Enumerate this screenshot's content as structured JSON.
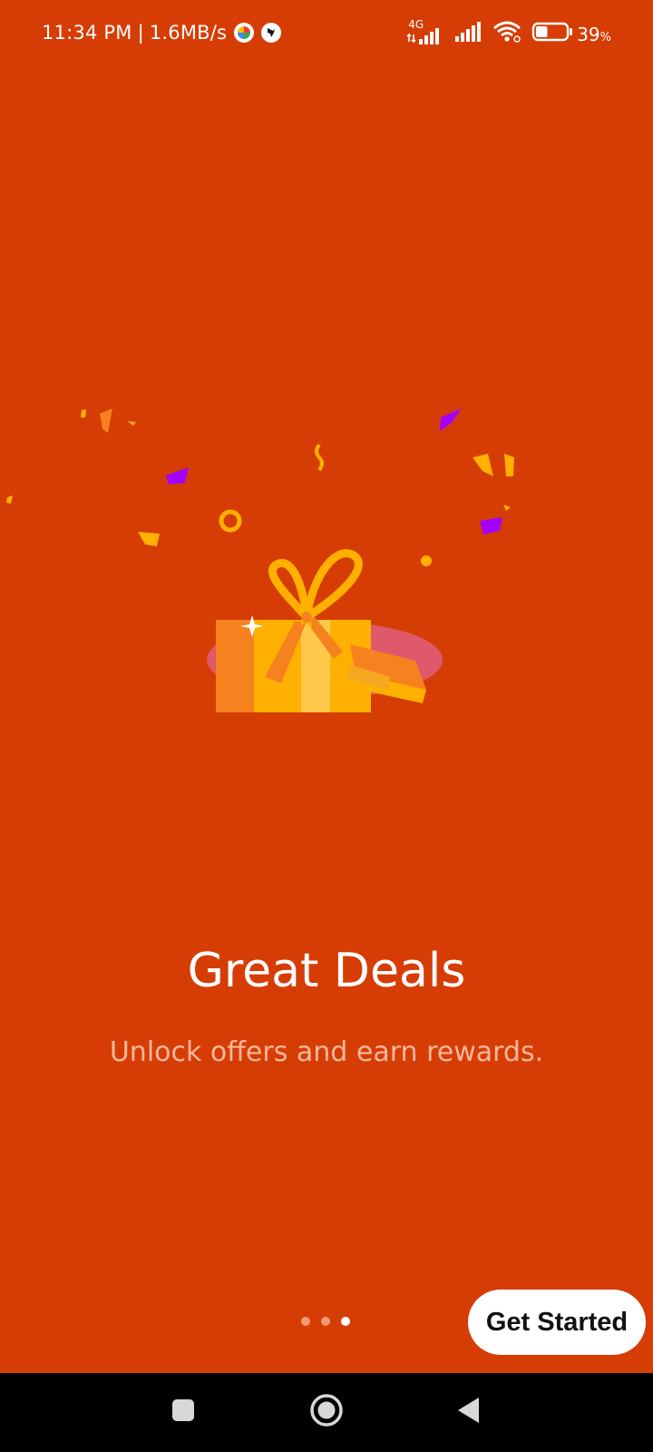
{
  "status_bar": {
    "time": "11:34 PM",
    "separator": "|",
    "net_speed": "1.6MB/s",
    "network_label": "4G",
    "battery_percent": "39",
    "battery_unit": "%",
    "battery_level": 0.39
  },
  "onboarding": {
    "title": "Great Deals",
    "subtitle": "Unlock offers and earn rewards.",
    "page_count": 3,
    "current_page": 3,
    "cta_label": "Get Started"
  },
  "colors": {
    "background": "#D63D05",
    "accent_yellow": "#FFB000",
    "confetti_purple": "#A400FF",
    "nav_bar": "#000000"
  },
  "icons": {
    "app_icon_1": "pinwheel-icon",
    "app_icon_2": "bird-icon",
    "nav_recents": "square-recents-icon",
    "nav_home": "circle-home-icon",
    "nav_back": "triangle-back-icon"
  }
}
